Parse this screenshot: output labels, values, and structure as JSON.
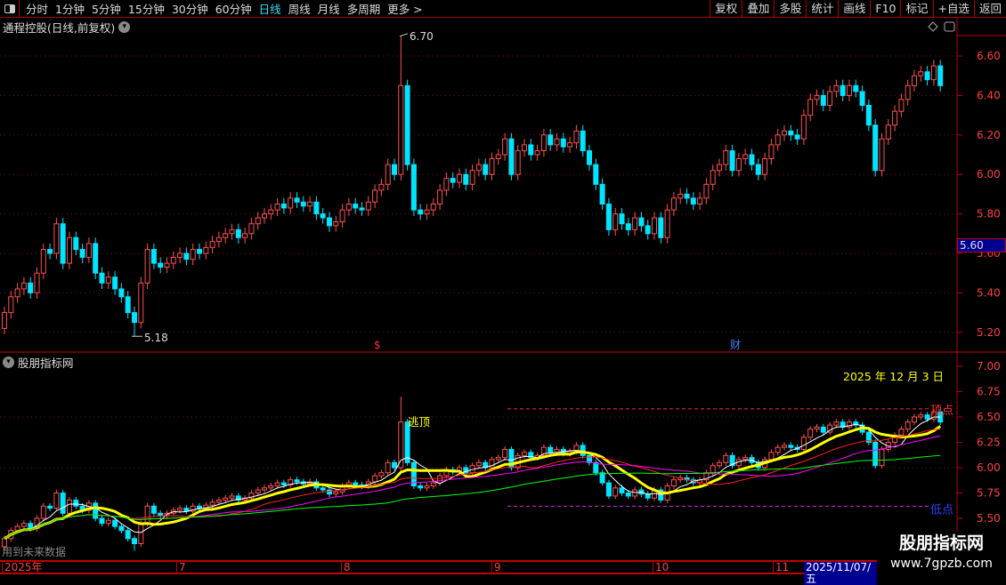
{
  "toolbar": {
    "periods": [
      "分时",
      "1分钟",
      "5分钟",
      "15分钟",
      "30分钟",
      "60分钟",
      "日线",
      "周线",
      "月线",
      "多周期",
      "更多 >"
    ],
    "active": "日线",
    "buttons": [
      "复权",
      "叠加",
      "多股",
      "统计",
      "画线",
      "F10",
      "标记",
      "+自选",
      "返回"
    ]
  },
  "main": {
    "title": "通程控股(日线,前复权)",
    "axis": [
      "6.60",
      "6.40",
      "6.20",
      "6.00",
      "5.80",
      "5.60",
      "5.40",
      "5.20"
    ],
    "current_price": "5.60",
    "high_label": "6.70",
    "low_label": "5.18",
    "markers": [
      "$",
      "财"
    ]
  },
  "indicator": {
    "title": "股朋指标网",
    "axis": [
      "7.00",
      "6.75",
      "6.50",
      "6.25",
      "6.00",
      "5.75",
      "5.50"
    ],
    "date_text": "2025 年 12 月 3 日",
    "top_label": "顶点",
    "bottom_label": "低点",
    "escape_label": "逃顶",
    "note": "用到未来数据"
  },
  "timeaxis": {
    "labels": [
      "2025年",
      "7",
      "8",
      "9",
      "10",
      "11"
    ],
    "cursor_date": "2025/11/07/五"
  },
  "watermark": {
    "name": "股朋指标网",
    "url": "www.7gpzb.com"
  },
  "colors": {
    "up": "#ff5050",
    "down": "#00e5ff",
    "ma5": "#ffffff",
    "ma10": "#ffff00",
    "ma20": "#ff2020",
    "ma30": "#ff00ff",
    "ma60": "#00ff00"
  },
  "chart_data": {
    "type": "candlestick",
    "ylim_main": [
      5.1,
      6.8
    ],
    "ylim_indicator": [
      5.45,
      7.05
    ],
    "closes": [
      5.3,
      5.38,
      5.42,
      5.45,
      5.4,
      5.5,
      5.62,
      5.6,
      5.75,
      5.55,
      5.68,
      5.62,
      5.58,
      5.65,
      5.5,
      5.45,
      5.48,
      5.42,
      5.38,
      5.3,
      5.25,
      5.45,
      5.62,
      5.55,
      5.53,
      5.55,
      5.58,
      5.6,
      5.57,
      5.62,
      5.6,
      5.63,
      5.66,
      5.68,
      5.7,
      5.72,
      5.68,
      5.7,
      5.75,
      5.78,
      5.8,
      5.82,
      5.85,
      5.83,
      5.88,
      5.86,
      5.84,
      5.86,
      5.8,
      5.78,
      5.74,
      5.76,
      5.82,
      5.85,
      5.83,
      5.82,
      5.86,
      5.92,
      5.95,
      6.05,
      6.0,
      6.45,
      6.05,
      5.82,
      5.8,
      5.82,
      5.85,
      5.92,
      5.98,
      5.96,
      6.0,
      5.95,
      6.02,
      6.05,
      6.0,
      6.08,
      6.1,
      6.18,
      6.0,
      6.12,
      6.15,
      6.1,
      6.12,
      6.2,
      6.15,
      6.18,
      6.14,
      6.16,
      6.22,
      6.12,
      6.05,
      5.95,
      5.85,
      5.72,
      5.8,
      5.75,
      5.72,
      5.78,
      5.74,
      5.7,
      5.78,
      5.68,
      5.82,
      5.88,
      5.9,
      5.88,
      5.85,
      5.88,
      5.95,
      6.02,
      6.05,
      6.12,
      6.02,
      6.08,
      6.1,
      6.05,
      6.0,
      6.08,
      6.15,
      6.2,
      6.22,
      6.2,
      6.18,
      6.3,
      6.38,
      6.4,
      6.35,
      6.42,
      6.45,
      6.4,
      6.45,
      6.42,
      6.35,
      6.25,
      6.02,
      6.18,
      6.25,
      6.32,
      6.38,
      6.45,
      6.5,
      6.52,
      6.48,
      6.55,
      6.45
    ],
    "first_open": 5.22,
    "max_high": 6.7,
    "min_low": 5.18
  }
}
